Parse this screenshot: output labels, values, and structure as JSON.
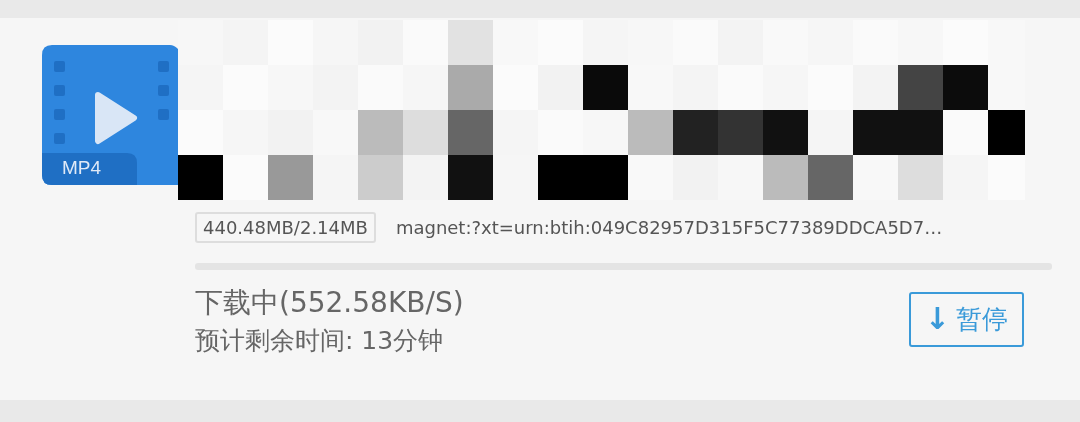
{
  "task": {
    "file_type": "MP4",
    "size": "440.48MB/2.14MB",
    "link": "magnet:?xt=urn:btih:049C82957D315F5C77389DDCA5D7…",
    "progress": {
      "level": 0
    },
    "status": "下载中(552.58KB/S)",
    "eta": "预计剩余时间: 13分钟",
    "action": {
      "icon": "↓",
      "label": "暂停"
    }
  }
}
